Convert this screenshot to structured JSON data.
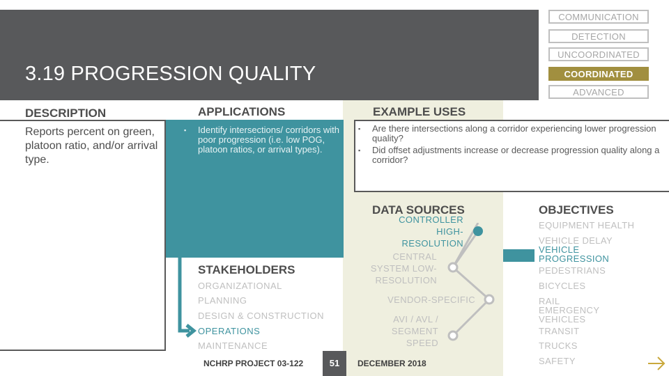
{
  "header": {
    "title": "3.19 PROGRESSION QUALITY"
  },
  "levels": [
    {
      "label": "COMMUNICATION",
      "active": false
    },
    {
      "label": "DETECTION",
      "active": false
    },
    {
      "label": "UNCOORDINATED",
      "active": false
    },
    {
      "label": "COORDINATED",
      "active": true
    },
    {
      "label": "ADVANCED",
      "active": false
    }
  ],
  "description": {
    "heading": "DESCRIPTION",
    "text": "Reports percent on green, platoon ratio, and/or arrival type."
  },
  "applications": {
    "heading": "APPLICATIONS",
    "items": [
      "Identify intersections/ corridors with poor progression (i.e. low POG, platoon ratios, or arrival types)."
    ]
  },
  "example_uses": {
    "heading": "EXAMPLE USES",
    "items": [
      "Are there intersections along a corridor experiencing lower progression quality?",
      "Did offset adjustments increase or decrease progression quality along a corridor?"
    ]
  },
  "stakeholders": {
    "heading": "STAKEHOLDERS",
    "items": [
      {
        "label": "ORGANIZATIONAL",
        "active": false
      },
      {
        "label": "PLANNING",
        "active": false
      },
      {
        "label": "DESIGN & CONSTRUCTION",
        "active": false
      },
      {
        "label": "OPERATIONS",
        "active": true
      },
      {
        "label": "MAINTENANCE",
        "active": false
      }
    ]
  },
  "data_sources": {
    "heading": "DATA SOURCES",
    "items": [
      {
        "label": "CONTROLLER HIGH-RESOLUTION",
        "active": true
      },
      {
        "label": "CENTRAL SYSTEM LOW-RESOLUTION",
        "active": false
      },
      {
        "label": "VENDOR-SPECIFIC",
        "active": false
      },
      {
        "label": "AVI / AVL / SEGMENT SPEED",
        "active": false
      }
    ]
  },
  "objectives": {
    "heading": "OBJECTIVES",
    "items": [
      {
        "label": "EQUIPMENT HEALTH",
        "active": false
      },
      {
        "label": "VEHICLE DELAY",
        "active": false
      },
      {
        "label": "VEHICLE PROGRESSION",
        "active": true
      },
      {
        "label": "PEDESTRIANS",
        "active": false
      },
      {
        "label": "BICYCLES",
        "active": false
      },
      {
        "label": "RAIL EMERGENCY VEHICLES",
        "active": false
      },
      {
        "label": "TRANSIT",
        "active": false
      },
      {
        "label": "TRUCKS",
        "active": false
      },
      {
        "label": "SAFETY",
        "active": false
      }
    ]
  },
  "footer": {
    "project": "NCHRP PROJECT 03-122",
    "page": "51",
    "date": "DECEMBER 2018",
    "next_icon": "arrow-right-icon"
  },
  "colors": {
    "teal": "#3f939f",
    "gold": "#a18f3f",
    "header_gray": "#58595b",
    "beige": "#efefdf",
    "inactive": "#bfbfbf"
  }
}
